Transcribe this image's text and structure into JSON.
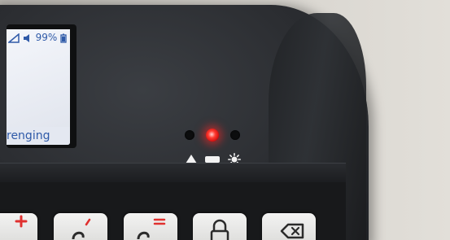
{
  "screen": {
    "status_text": "◀¹99%",
    "battery_percent_text": "99%",
    "footer_text": "renging"
  },
  "indicators": [
    {
      "name": "left-led",
      "state": "off"
    },
    {
      "name": "center-led",
      "state": "on",
      "color": "#ff3b30"
    },
    {
      "name": "right-led",
      "state": "off"
    }
  ],
  "indicator_symbols": [
    "triangle-icon",
    "bar-icon",
    "sun-icon"
  ],
  "keys": [
    {
      "name": "plus-key",
      "icon": "plus-icon",
      "accent": "#e0312f"
    },
    {
      "name": "key-two",
      "icon": "digit-icon",
      "accent": "#e0312f"
    },
    {
      "name": "equals-key",
      "icon": "equals-icon",
      "accent": "#e0312f"
    },
    {
      "name": "lock-key",
      "icon": "lock-icon"
    },
    {
      "name": "backspace-key",
      "icon": "backspace-icon"
    }
  ],
  "colors": {
    "device_body": "#2b2d31",
    "screen_text": "#2f5aa8",
    "led_active": "#ff3b30"
  }
}
